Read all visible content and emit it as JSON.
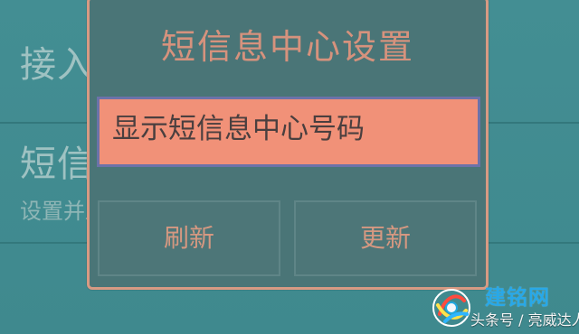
{
  "background": {
    "item1": {
      "title": "接入点名称"
    },
    "item2": {
      "title": "短信息中心设置",
      "subtitle": "设置并显示短信息中心号码"
    }
  },
  "dialog": {
    "title": "短信息中心设置",
    "option_label": "显示短信息中心号码",
    "buttons": {
      "refresh": "刷新",
      "update": "更新"
    }
  },
  "watermark": {
    "brand": "建铭网",
    "source": "头条号 / 亮威达人"
  },
  "colors": {
    "background": "#3f898e",
    "dialog_background": "#4a7577",
    "dialog_border": "#d79a83",
    "accent_text": "#d6927d",
    "option_highlight": "#f19178",
    "option_border": "#6c72a9",
    "brand_blue": "#28a8e8"
  }
}
